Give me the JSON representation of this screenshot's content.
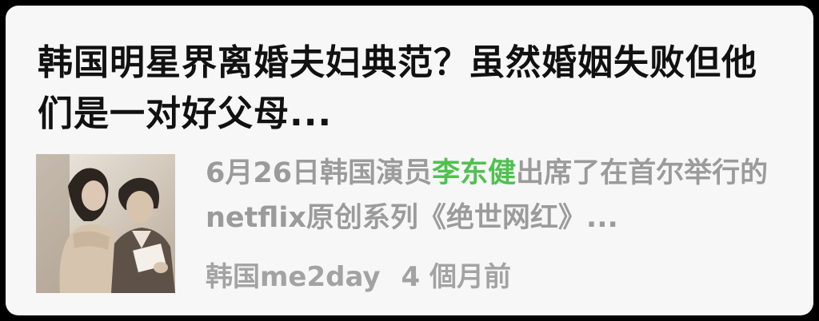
{
  "article": {
    "title": "韩国明星界离婚夫妇典范？虽然婚姻失败但他们是一对好父母...",
    "summary": {
      "prefix": "6月26日韩国演员",
      "highlight": "李东健",
      "suffix": "出席了在首尔举行的netflix原创系列《绝世网红》..."
    },
    "source": "韩国me2day",
    "time": "4 個月前",
    "thumbnail_icon": "news-photo-thumbnail",
    "highlight_color": "#4fc14f"
  }
}
